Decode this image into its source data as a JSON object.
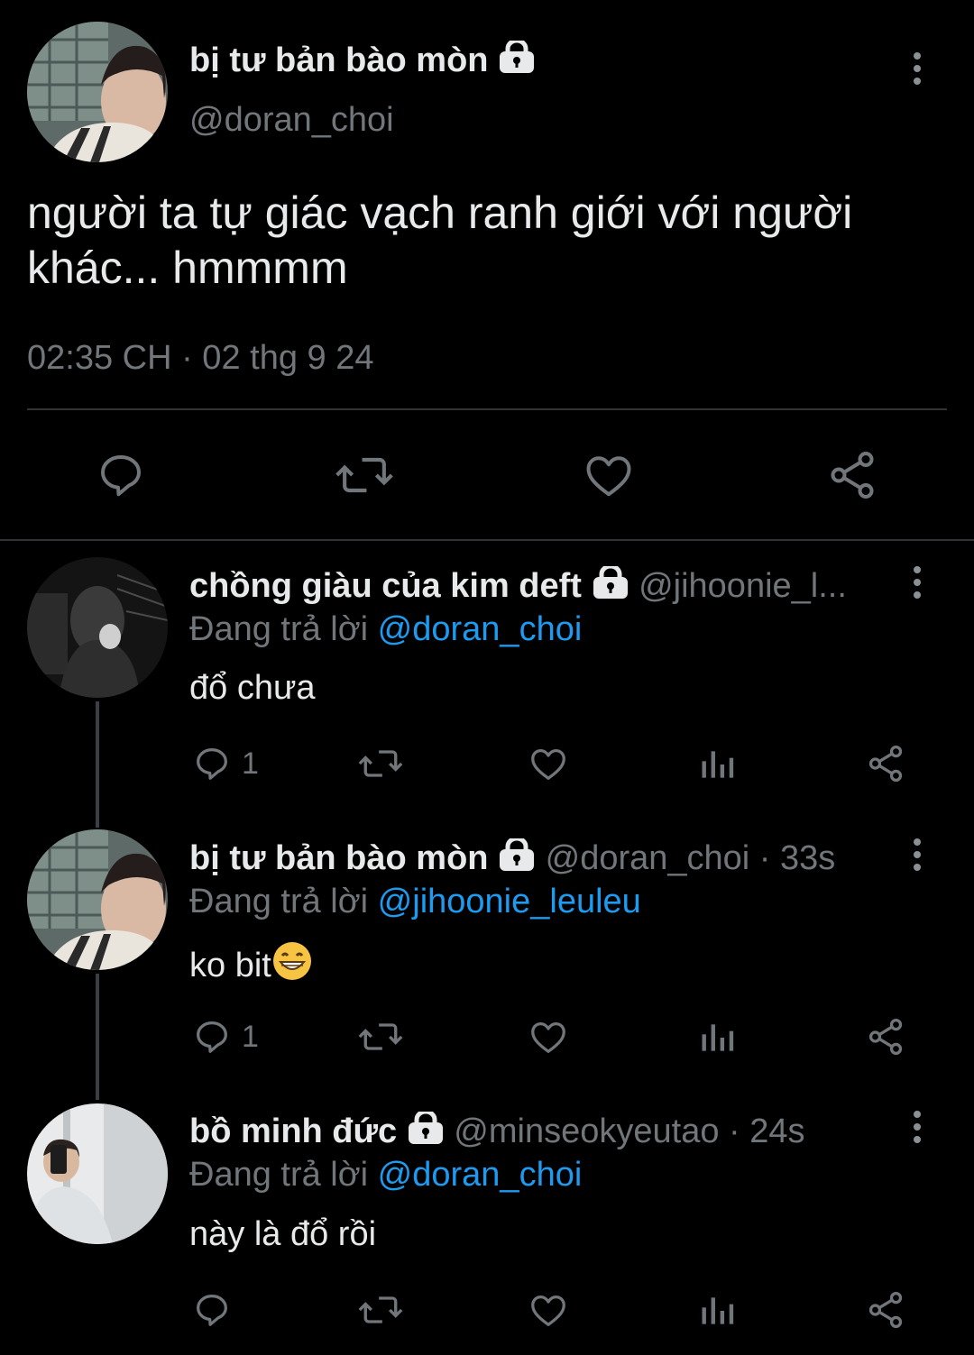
{
  "main_tweet": {
    "display_name": "bị tư bản bào mòn",
    "handle": "@doran_choi",
    "text": "người ta tự giác vạch ranh giới với người khác... hmmmm",
    "timestamp": "02:35 CH · 02 thg 9 24"
  },
  "replies": [
    {
      "display_name": "chồng giàu của kim deft",
      "handle": "@jihoonie_l...",
      "time": "",
      "replying_prefix": "Đang trả lời",
      "replying_to": "@doran_choi",
      "text": "đổ chưa",
      "reply_count": "1"
    },
    {
      "display_name": "bị tư bản bào mòn",
      "handle": "@doran_choi",
      "time": "· 33s",
      "replying_prefix": "Đang trả lời",
      "replying_to": "@jihoonie_leuleu",
      "text": "ko bit",
      "reply_count": "1"
    },
    {
      "display_name": "bồ minh đức",
      "handle": "@minseokyeutao",
      "time": "· 24s",
      "replying_prefix": "Đang trả lời",
      "replying_to": "@doran_choi",
      "text": "này là đổ rồi",
      "reply_count": ""
    }
  ],
  "icons": {
    "reply": "reply-icon",
    "retweet": "retweet-icon",
    "like": "heart-icon",
    "views": "views-icon",
    "share": "share-icon",
    "more": "more-icon",
    "protected": "lock-icon",
    "emoji": "grinning-emoji-icon"
  },
  "colors": {
    "background": "#000000",
    "text": "#e7e9ea",
    "muted": "#71767b",
    "link": "#1d9bf0"
  }
}
